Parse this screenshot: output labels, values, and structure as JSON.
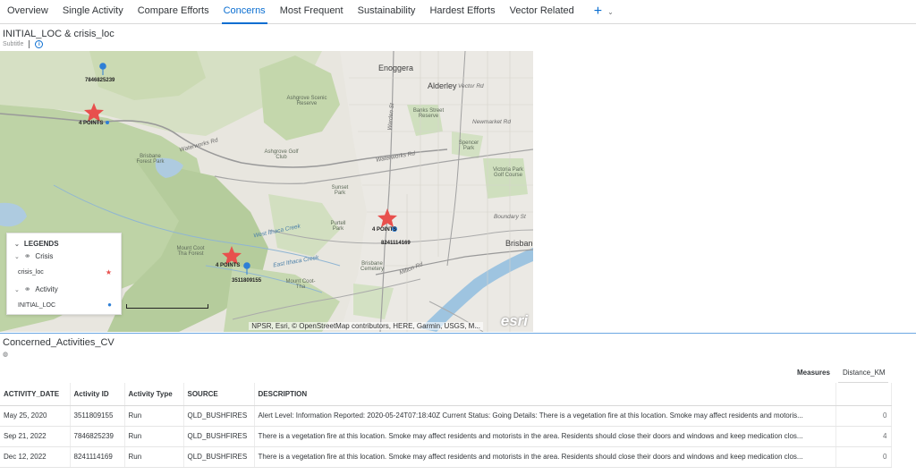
{
  "tabs": [
    {
      "label": "Overview"
    },
    {
      "label": "Single Activity"
    },
    {
      "label": "Compare Efforts"
    },
    {
      "label": "Concerns"
    },
    {
      "label": "Most Frequent"
    },
    {
      "label": "Sustainability"
    },
    {
      "label": "Hardest Efforts"
    },
    {
      "label": "Vector Related"
    }
  ],
  "active_tab": "Concerns",
  "map_widget": {
    "title": "INITIAL_LOC & crisis_loc",
    "subtitle": "Subtitle",
    "attribution": "NPSR, Esri, © OpenStreetMap contributors, HERE, Garmin, USGS, M...",
    "logo": "esri",
    "place_labels": {
      "enoggera": "Enoggera",
      "alderley": "Alderley",
      "ashgrove_scenic": "Ashgrove Scenic Reserve",
      "banks_street": "Banks Street Reserve",
      "newmarket_rd": "Newmarket Rd",
      "spencer_park": "Spencer Park",
      "victoria_park": "Victoria Park Golf Course",
      "ashgrove_golf": "Ashgrove Golf Club",
      "waterworks_rd_w": "Waterworks Rd",
      "waterworks_rd_e": "Waterworks Rd",
      "brisbane_forest": "Brisbane Forest Park",
      "sunset_park": "Sunset Park",
      "purtell_park": "Purtell Park",
      "west_ithaca": "West Ithaca Creek",
      "east_ithaca": "East Ithaca Creek",
      "mount_coot_tha_forest": "Mount Coot Tha Forest",
      "mount_coot_tha": "Mount Coot-Tha",
      "brisbane_cemetery": "Brisbane Cemetery",
      "milton_rd": "Milton Rd",
      "brisbane": "Brisbane",
      "boundary_st": "Boundary St",
      "vector_rd": "Vector Rd",
      "warden_st": "Warden St"
    },
    "points": {
      "p1": "7846825239",
      "c1": "4 POINTS",
      "c2": "4 POINTS",
      "p2": "8241114169",
      "c3": "4 POINTS",
      "p3": "3511809155"
    },
    "legend": {
      "title": "LEGENDS",
      "groups": [
        {
          "name": "Crisis",
          "item": "crisis_loc",
          "symbol": "red-star",
          "color": "#e8504d"
        },
        {
          "name": "Activity",
          "item": "INITIAL_LOC",
          "symbol": "blue-pin",
          "color": "#2e7fd6"
        }
      ]
    }
  },
  "table_widget": {
    "title": "Concerned_Activities_CV",
    "measures_label": "Measures",
    "measure_column": "Distance_KM",
    "columns": [
      "ACTIVITY_DATE",
      "Activity ID",
      "Activity Type",
      "SOURCE",
      "DESCRIPTION"
    ],
    "rows": [
      {
        "date": "May 25, 2020",
        "id": "3511809155",
        "type": "Run",
        "source": "QLD_BUSHFIRES",
        "description": "Alert Level: Information Reported: 2020-05-24T07:18:40Z Current Status: Going Details: There is a vegetation fire at this location. Smoke may affect residents and motoris...",
        "distance": "0"
      },
      {
        "date": "Sep 21, 2022",
        "id": "7846825239",
        "type": "Run",
        "source": "QLD_BUSHFIRES",
        "description": "There is a vegetation fire at this location. Smoke may affect residents and motorists in the area. Residents should close their doors and windows and keep medication clos...",
        "distance": "4"
      },
      {
        "date": "Dec 12, 2022",
        "id": "8241114169",
        "type": "Run",
        "source": "QLD_BUSHFIRES",
        "description": "There is a vegetation fire at this location. Smoke may affect residents and motorists in the area. Residents should close their doors and windows and keep medication clos...",
        "distance": "0"
      }
    ]
  },
  "colors": {
    "accent": "#0a6ed1",
    "crisis": "#e8504d",
    "activity": "#2e7fd6"
  }
}
